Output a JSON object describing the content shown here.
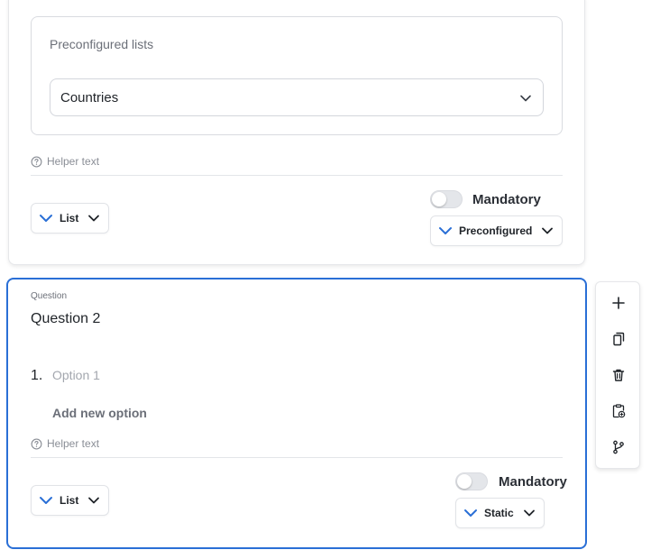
{
  "question1": {
    "preconfigured_label": "Preconfigured lists",
    "preconfigured_value": "Countries",
    "helper_text": "Helper text",
    "type_label": "List",
    "mandatory_label": "Mandatory",
    "mandatory_on": false,
    "source_label": "Preconfigured"
  },
  "question2": {
    "caption": "Question",
    "title": "Question 2",
    "options": [
      {
        "number": "1.",
        "placeholder": "Option 1"
      }
    ],
    "add_option_label": "Add new option",
    "helper_text": "Helper text",
    "type_label": "List",
    "mandatory_label": "Mandatory",
    "mandatory_on": false,
    "source_label": "Static"
  },
  "toolbar": {
    "items": [
      "plus-icon",
      "duplicate-icon",
      "trash-icon",
      "import-icon",
      "branch-icon"
    ]
  },
  "colors": {
    "accent": "#2a6fd6",
    "border": "#d9dbe0",
    "muted_text": "#8a8e96"
  }
}
